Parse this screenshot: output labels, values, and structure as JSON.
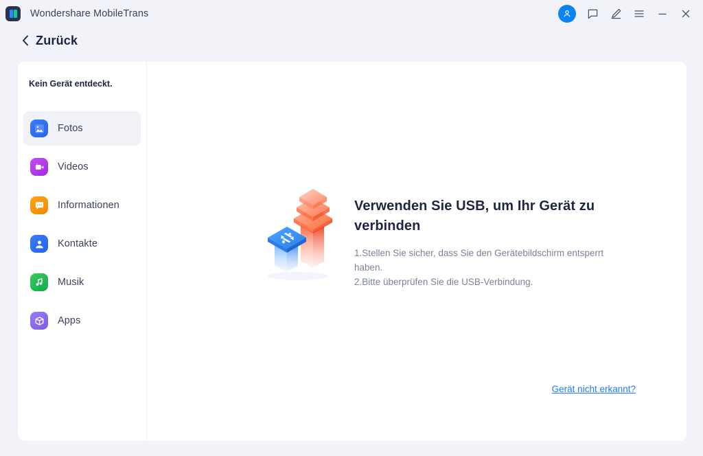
{
  "window": {
    "title": "Wondershare MobileTrans",
    "logo_icon": "mobiletrans-logo-icon",
    "controls": [
      {
        "name": "account-avatar-button",
        "icon": "user-avatar-icon",
        "label": ""
      },
      {
        "name": "feedback-button",
        "icon": "comment-icon",
        "label": ""
      },
      {
        "name": "edit-button",
        "icon": "pen-icon",
        "label": ""
      },
      {
        "name": "menu-button",
        "icon": "hamburger-menu-icon",
        "label": ""
      },
      {
        "name": "minimize-button",
        "icon": "minimize-icon",
        "label": ""
      },
      {
        "name": "close-button",
        "icon": "close-icon",
        "label": ""
      }
    ]
  },
  "nav": {
    "back_label": "Zurück",
    "back_icon": "chevron-left-icon"
  },
  "sidebar": {
    "header": "Kein Gerät entdeckt.",
    "items": [
      {
        "label": "Fotos",
        "icon": "photos-icon",
        "active": true
      },
      {
        "label": "Videos",
        "icon": "videos-icon",
        "active": false
      },
      {
        "label": "Informationen",
        "icon": "messages-icon",
        "active": false
      },
      {
        "label": "Kontakte",
        "icon": "contacts-icon",
        "active": false
      },
      {
        "label": "Musik",
        "icon": "music-icon",
        "active": false
      },
      {
        "label": "Apps",
        "icon": "apps-icon",
        "active": false
      }
    ]
  },
  "main": {
    "illustration_icon": "usb-transfer-illustration",
    "title": "Verwenden Sie USB, um Ihr Gerät zu verbinden",
    "description_line1": "1.Stellen Sie sicher, dass Sie den Gerätebildschirm entsperrt haben.",
    "description_line2": "2.Bitte überprüfen Sie die USB-Verbindung.",
    "help_link": "Gerät nicht erkannt?"
  },
  "colors": {
    "page_background": "#f2f3f8",
    "card_background": "#ffffff",
    "accent_blue": "#1a7dfa",
    "text_primary": "#1c2541",
    "text_secondary": "#7c8398",
    "active_item_background": "#f0f2f8"
  }
}
